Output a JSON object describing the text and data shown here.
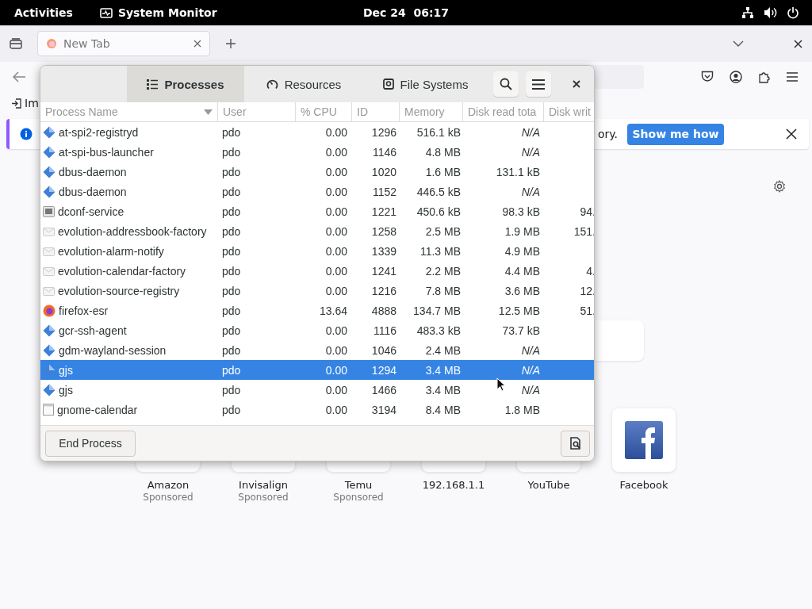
{
  "top_bar": {
    "activities": "Activities",
    "app_name": "System Monitor",
    "clock": "Dec 24  06:17"
  },
  "browser": {
    "tabs": [
      {
        "title": "New Tab",
        "selected": true
      }
    ],
    "bookmark": "Im",
    "notification": {
      "text": "ory.",
      "button": "Show me how"
    },
    "shortcuts": [
      {
        "label": "Amazon",
        "sponsored": "Sponsored",
        "kind": "blank"
      },
      {
        "label": "Invisalign",
        "sponsored": "Sponsored",
        "kind": "blank"
      },
      {
        "label": "Temu",
        "sponsored": "Sponsored",
        "kind": "blank"
      },
      {
        "label": "192.168.1.1",
        "kind": "blank"
      },
      {
        "label": "YouTube",
        "kind": "blank"
      },
      {
        "label": "Facebook",
        "kind": "facebook"
      }
    ]
  },
  "system_monitor": {
    "tabs": [
      {
        "label": "Processes",
        "selected": true
      },
      {
        "label": "Resources",
        "selected": false
      },
      {
        "label": "File Systems",
        "selected": false
      }
    ],
    "columns": [
      {
        "label": "Process Name",
        "sorted": true
      },
      {
        "label": "User",
        "sorted": false
      },
      {
        "label": "% CPU",
        "sorted": false
      },
      {
        "label": "ID",
        "sorted": false
      },
      {
        "label": "Memory",
        "sorted": false
      },
      {
        "label": "Disk read tota",
        "sorted": false
      },
      {
        "label": "Disk writ",
        "sorted": false
      }
    ],
    "rows": [
      {
        "name": "at-spi2-registryd",
        "kind": "system",
        "user": "pdo",
        "cpu": "0.00",
        "id": "1296",
        "memory": "516.1 kB",
        "disk_read": "N/A",
        "disk_read_na": true,
        "selected": false
      },
      {
        "name": "at-spi-bus-launcher",
        "kind": "system",
        "user": "pdo",
        "cpu": "0.00",
        "id": "1146",
        "memory": "4.8 MB",
        "disk_read": "N/A",
        "disk_read_na": true,
        "selected": false
      },
      {
        "name": "dbus-daemon",
        "kind": "system",
        "user": "pdo",
        "cpu": "0.00",
        "id": "1020",
        "memory": "1.6 MB",
        "disk_read": "131.1 kB",
        "disk_read_na": false,
        "selected": false
      },
      {
        "name": "dbus-daemon",
        "kind": "system",
        "user": "pdo",
        "cpu": "0.00",
        "id": "1152",
        "memory": "446.5 kB",
        "disk_read": "N/A",
        "disk_read_na": true,
        "selected": false
      },
      {
        "name": "dconf-service",
        "kind": "terminal",
        "user": "pdo",
        "cpu": "0.00",
        "id": "1221",
        "memory": "450.6 kB",
        "disk_read": "98.3 kB",
        "disk_read_na": false,
        "disk_write": "94.",
        "selected": false
      },
      {
        "name": "evolution-addressbook-factory",
        "kind": "mail",
        "user": "pdo",
        "cpu": "0.00",
        "id": "1258",
        "memory": "2.5 MB",
        "disk_read": "1.9 MB",
        "disk_read_na": false,
        "disk_write": "151.",
        "selected": false
      },
      {
        "name": "evolution-alarm-notify",
        "kind": "mail",
        "user": "pdo",
        "cpu": "0.00",
        "id": "1339",
        "memory": "11.3 MB",
        "disk_read": "4.9 MB",
        "disk_read_na": false,
        "selected": false
      },
      {
        "name": "evolution-calendar-factory",
        "kind": "mail",
        "user": "pdo",
        "cpu": "0.00",
        "id": "1241",
        "memory": "2.2 MB",
        "disk_read": "4.4 MB",
        "disk_read_na": false,
        "disk_write": "4.",
        "selected": false
      },
      {
        "name": "evolution-source-registry",
        "kind": "mail",
        "user": "pdo",
        "cpu": "0.00",
        "id": "1216",
        "memory": "7.8 MB",
        "disk_read": "3.6 MB",
        "disk_read_na": false,
        "disk_write": "12.",
        "selected": false
      },
      {
        "name": "firefox-esr",
        "kind": "browser",
        "user": "pdo",
        "cpu": "13.64",
        "id": "4888",
        "memory": "134.7 MB",
        "disk_read": "12.5 MB",
        "disk_read_na": false,
        "disk_write": "51.",
        "selected": false
      },
      {
        "name": "gcr-ssh-agent",
        "kind": "system",
        "user": "pdo",
        "cpu": "0.00",
        "id": "1116",
        "memory": "483.3 kB",
        "disk_read": "73.7 kB",
        "disk_read_na": false,
        "selected": false
      },
      {
        "name": "gdm-wayland-session",
        "kind": "system",
        "user": "pdo",
        "cpu": "0.00",
        "id": "1046",
        "memory": "2.4 MB",
        "disk_read": "N/A",
        "disk_read_na": true,
        "selected": false
      },
      {
        "name": "gjs",
        "kind": "system",
        "user": "pdo",
        "cpu": "0.00",
        "id": "1294",
        "memory": "3.4 MB",
        "disk_read": "N/A",
        "disk_read_na": true,
        "selected": true
      },
      {
        "name": "gjs",
        "kind": "system",
        "user": "pdo",
        "cpu": "0.00",
        "id": "1466",
        "memory": "3.4 MB",
        "disk_read": "N/A",
        "disk_read_na": true,
        "selected": false
      },
      {
        "name": "gnome-calendar",
        "kind": "document",
        "user": "pdo",
        "cpu": "0.00",
        "id": "3194",
        "memory": "8.4 MB",
        "disk_read": "1.8 MB",
        "disk_read_na": false,
        "selected": false
      }
    ],
    "end_button": "End Process"
  }
}
